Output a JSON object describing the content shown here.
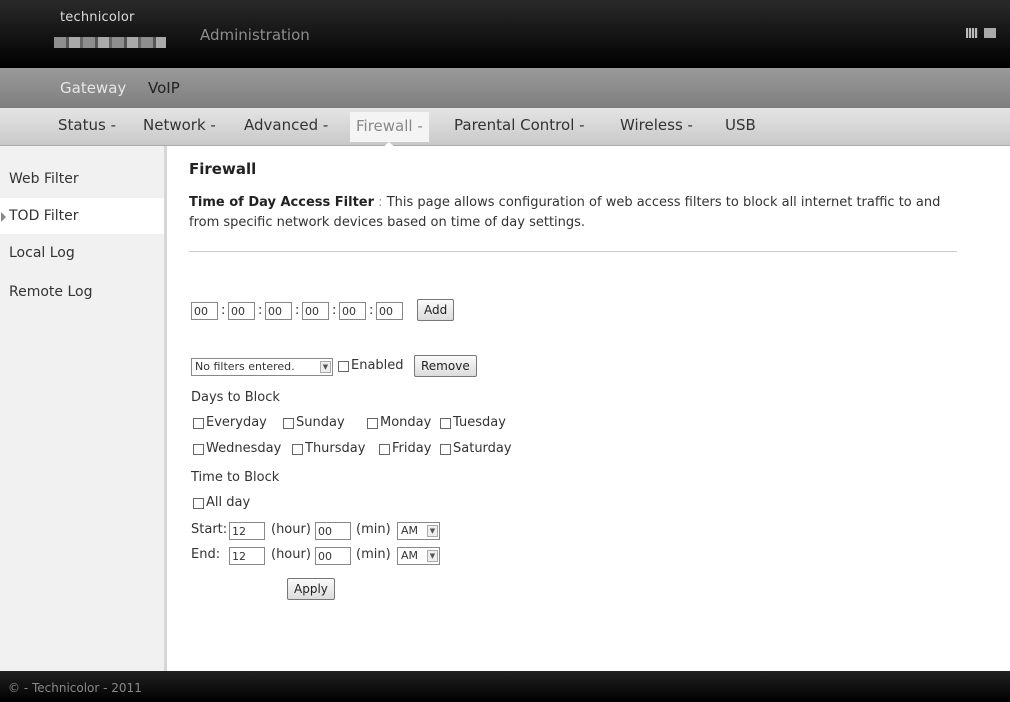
{
  "header": {
    "logo_text": "technicolor",
    "title": "Administration",
    "icons": [
      "grid-icon",
      "book-icon"
    ]
  },
  "topnav": {
    "items": [
      "Gateway",
      "VoIP"
    ],
    "active": "Gateway"
  },
  "subnav": {
    "items": [
      "Status -",
      "Network -",
      "Advanced -",
      "Firewall -",
      "Parental Control -",
      "Wireless -",
      "USB"
    ],
    "active": "Firewall -"
  },
  "sidebar": {
    "items": [
      "Web Filter",
      "TOD Filter",
      "Local Log",
      "Remote Log"
    ],
    "active": "TOD Filter"
  },
  "main": {
    "title": "Firewall",
    "desc_bold": "Time of Day Access Filter",
    "desc_sep": ":",
    "desc_text": "This page allows configuration of web access filters to block all internet traffic to and from specific network devices based on time of day settings.",
    "mac_fields": [
      "00",
      "00",
      "00",
      "00",
      "00",
      "00"
    ],
    "mac_separator": ":",
    "add_label": "Add",
    "filter_select": "No filters entered.",
    "enabled_label": "Enabled",
    "remove_label": "Remove",
    "days_heading": "Days to Block",
    "days": [
      "Everyday",
      "Sunday",
      "Monday",
      "Tuesday",
      "Wednesday",
      "Thursday",
      "Friday",
      "Saturday"
    ],
    "time_heading": "Time to Block",
    "all_day_label": "All day",
    "start_label": "Start:",
    "end_label": "End:",
    "start_hour": "12",
    "start_min": "00",
    "start_ampm": "AM",
    "end_hour": "12",
    "end_min": "00",
    "end_ampm": "AM",
    "hour_unit": "(hour)",
    "min_unit": "(min)",
    "apply_label": "Apply"
  },
  "footer": {
    "text": "© - Technicolor - 2011"
  }
}
